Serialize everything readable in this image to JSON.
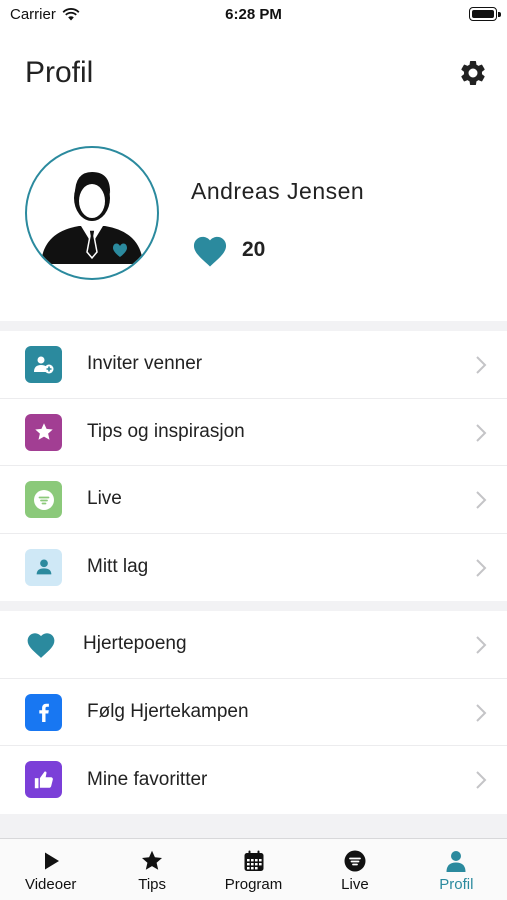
{
  "status_bar": {
    "carrier": "Carrier",
    "time": "6:28 PM"
  },
  "header": {
    "title": "Profil",
    "settings_icon": "gear-icon"
  },
  "profile": {
    "name": "Andreas Jensen",
    "heart_points": "20"
  },
  "colors": {
    "accent": "#2b8a9e",
    "separator": "#f2f2f4",
    "text": "#222222"
  },
  "menu_group_1": [
    {
      "label": "Inviter venner",
      "icon": "add-user-icon",
      "color": "#2b8a9e"
    },
    {
      "label": "Tips og inspirasjon",
      "icon": "star-icon",
      "color": "#a23e93"
    },
    {
      "label": "Live",
      "icon": "live-icon",
      "color": "#8bc97a"
    },
    {
      "label": "Mitt lag",
      "icon": "person-icon",
      "color": "#cfe8f6"
    }
  ],
  "menu_group_2": [
    {
      "label": "Hjertepoeng",
      "icon": "heart-icon",
      "color": "#2b8a9e"
    },
    {
      "label": "Følg Hjertekampen",
      "icon": "facebook-icon",
      "color": "#1877f2"
    },
    {
      "label": "Mine favoritter",
      "icon": "thumbs-up-icon",
      "color": "#7b3fd8"
    }
  ],
  "tabs": [
    {
      "label": "Videoer",
      "icon": "play-icon",
      "active": false
    },
    {
      "label": "Tips",
      "icon": "star-icon",
      "active": false
    },
    {
      "label": "Program",
      "icon": "calendar-icon",
      "active": false
    },
    {
      "label": "Live",
      "icon": "live-icon",
      "active": false
    },
    {
      "label": "Profil",
      "icon": "person-icon",
      "active": true
    }
  ]
}
